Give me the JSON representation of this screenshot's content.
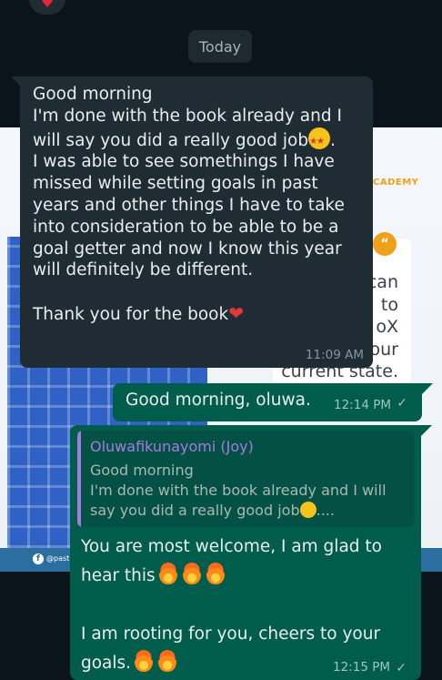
{
  "date_separator": "Today",
  "incoming": {
    "lines": [
      "Good morning",
      "I'm done with the book already and I will say you did a really good job",
      ".",
      "I was able to see somethings I have missed while setting goals in past years and other things I have to take into consideration to be able to be a goal getter and now I know this year will definitely be different.",
      "",
      "Thank you for the book"
    ],
    "time": "11:09 AM"
  },
  "outgoing_1": {
    "text": "Good morning, oluwa.",
    "time": "12:14 PM"
  },
  "outgoing_2": {
    "quoted_author": "Oluwafikunayomi (Joy)",
    "quoted_line1": "Good morning",
    "quoted_line2": "I'm done with the book already and I will say you did a really good job",
    "quoted_ellipsis": "....",
    "text_line1": "You are most welcome, I am glad to hear this",
    "text_line2": "I am rooting for you, cheers to your goals.",
    "time": "12:15 PM"
  },
  "background": {
    "academy_label": "CADEMY",
    "quote_badge": "“",
    "card_lines": [
      "can",
      "to",
      "oX",
      "our",
      "current state."
    ],
    "strip_handle": "@past"
  },
  "ticks": "✓",
  "colors": {
    "incoming_bubble": "#1f2c33",
    "outgoing_bubble": "#005c4b",
    "quote_author": "#a57be0"
  },
  "icons": [
    "heart-icon",
    "star-struck-emoji-icon",
    "red-heart-emoji-icon",
    "fire-emoji-icon",
    "read-check-icon",
    "facebook-icon"
  ]
}
